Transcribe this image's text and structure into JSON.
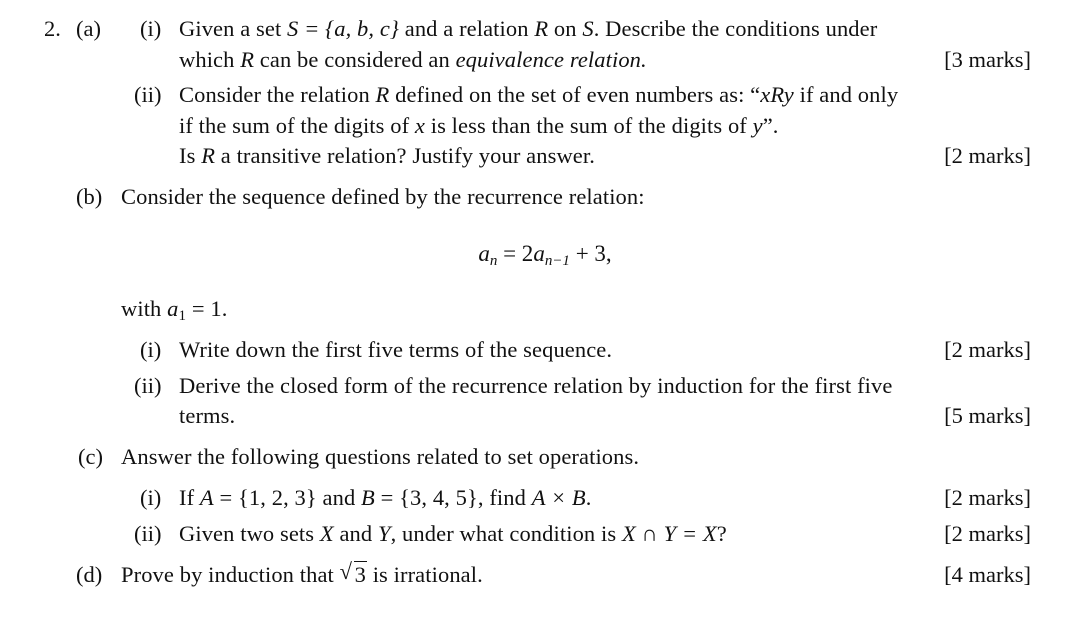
{
  "question_number": "2.",
  "parts": {
    "a": {
      "label": "(a)",
      "i": {
        "label": "(i)",
        "line1_pre": "Given a set ",
        "line1_math1": "S = {a, b, c}",
        "line1_mid": " and a relation ",
        "line1_math2": "R",
        "line1_mid2": " on ",
        "line1_math3": "S",
        "line1_post": ". Describe the conditions under",
        "line2_pre": "which ",
        "line2_math": "R",
        "line2_mid": " can be considered an ",
        "line2_em": "equivalence relation.",
        "marks": "[3 marks]"
      },
      "ii": {
        "label": "(ii)",
        "line1_pre": "Consider the relation ",
        "line1_math": "R",
        "line1_post": " defined on the set of even numbers as: “",
        "line1_math2": "xRy",
        "line1_post2": " if and only",
        "line2_pre": "if the sum of the digits of ",
        "line2_math": "x",
        "line2_mid": " is less than the sum of the digits of ",
        "line2_math2": "y",
        "line2_post": "”.",
        "line3_pre": "Is ",
        "line3_math": "R",
        "line3_post": " a transitive relation? Justify your answer.",
        "marks": "[2 marks]"
      }
    },
    "b": {
      "label": "(b)",
      "intro": "Consider the sequence defined by the recurrence relation:",
      "equation": {
        "lhs_var": "a",
        "lhs_sub": "n",
        "eq": " = 2",
        "rhs_var": "a",
        "rhs_sub": "n−1",
        "rhs_post": " + 3,"
      },
      "with_pre": "with ",
      "with_var": "a",
      "with_sub": "1",
      "with_post": " = 1.",
      "i": {
        "label": "(i)",
        "text": "Write down the first five terms of the sequence.",
        "marks": "[2 marks]"
      },
      "ii": {
        "label": "(ii)",
        "line1": "Derive the closed form of the recurrence relation by induction for the first five",
        "line2": "terms.",
        "marks": "[5 marks]"
      }
    },
    "c": {
      "label": "(c)",
      "intro": "Answer the following questions related to set operations.",
      "i": {
        "label": "(i)",
        "pre": "If ",
        "math1": "A",
        "set1": " = {1, 2, 3}",
        "mid": " and ",
        "math2": "B",
        "set2": " = {3, 4, 5}",
        "mid2": ", find ",
        "math3": "A × B",
        "post": ".",
        "marks": "[2 marks]"
      },
      "ii": {
        "label": "(ii)",
        "pre": "Given two sets ",
        "math1": "X",
        "mid": " and ",
        "math2": "Y",
        "mid2": ", under what condition is ",
        "math3": "X ∩ Y = X",
        "post": "?",
        "marks": "[2 marks]"
      }
    },
    "d": {
      "label": "(d)",
      "pre": "Prove by induction that ",
      "radical": "√",
      "radicand": "3",
      "post": " is irrational.",
      "marks": "[4 marks]"
    }
  }
}
